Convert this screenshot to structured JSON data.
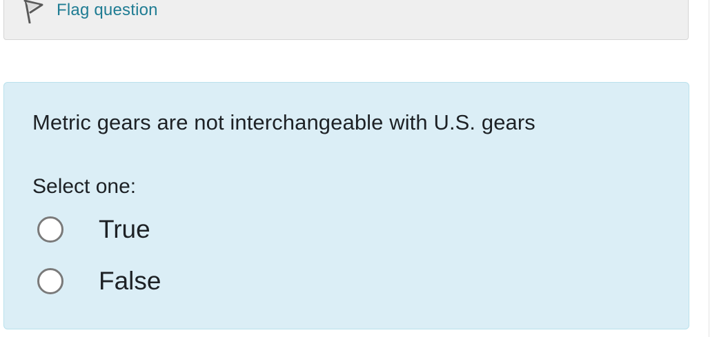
{
  "info": {
    "flag_icon": "flag-icon",
    "flag_label": "Flag question"
  },
  "question": {
    "text": "Metric gears are not interchangeable with U.S. gears",
    "prompt": "Select one:",
    "options": [
      {
        "label": "True",
        "selected": false
      },
      {
        "label": "False",
        "selected": false
      }
    ]
  },
  "colors": {
    "link": "#1f7c93",
    "question_bg": "#dbeef6",
    "question_border": "#b9e1ec",
    "info_bg": "#efefef",
    "text": "#1d2125"
  }
}
